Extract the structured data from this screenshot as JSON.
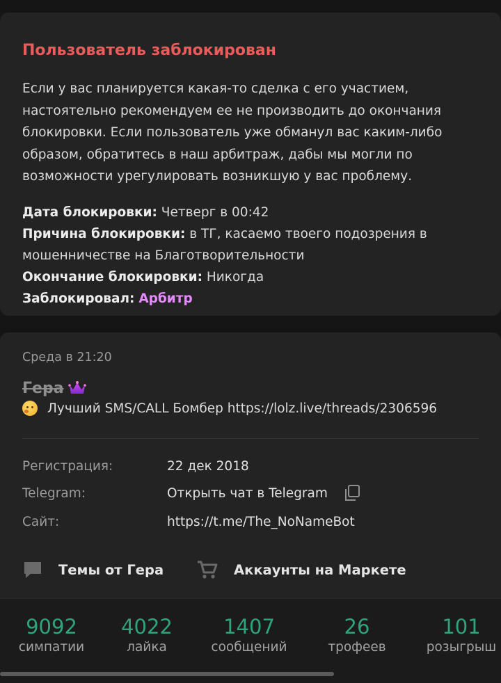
{
  "ban": {
    "title": "Пользователь заблокирован",
    "text": "Если у вас планируется какая-то сделка с его участием, настоятельно рекомендуем ее не производить до окончания блокировки. Если пользователь уже обманул вас каким-либо образом, обратитесь в наш арбитраж, дабы мы могли по возможности урегулировать возникшую у вас проблему.",
    "date_label": "Дата блокировки",
    "date_value": "Четверг в 00:42",
    "reason_label": "Причина блокировки",
    "reason_value": "в ТГ, касаемо твоего подозрения в мошенничестве на Благотворительности",
    "end_label": "Окончание блокировки",
    "end_value": "Никогда",
    "by_label": "Заблокировал",
    "by_value": "Арбитр"
  },
  "profile": {
    "last_seen": "Среда в 21:20",
    "name": "Гера",
    "status": "Лучший SMS/CALL Бомбер https://lolz.live/threads/2306596",
    "registration_label": "Регистрация:",
    "registration_value": "22 дек 2018",
    "telegram_label": "Telegram:",
    "telegram_value": "Открыть чат в Telegram",
    "site_label": "Сайт:",
    "site_value": "https://t.me/The_NoNameBot",
    "threads_link": "Темы от Гера",
    "market_link": "Аккаунты на Маркете"
  },
  "stats": [
    {
      "value": "9092",
      "label": "симпатии"
    },
    {
      "value": "4022",
      "label": "лайка"
    },
    {
      "value": "1407",
      "label": "сообщений"
    },
    {
      "value": "26",
      "label": "трофеев"
    },
    {
      "value": "101",
      "label": "розыгрыш"
    }
  ],
  "colors": {
    "ban_title": "#ec5b5b",
    "arbitr": "#e48bff",
    "stat_value": "#2fa37d"
  },
  "icons": [
    "crown-icon",
    "emoji-icon",
    "copy-icon",
    "chat-bubble-icon",
    "cart-icon"
  ]
}
